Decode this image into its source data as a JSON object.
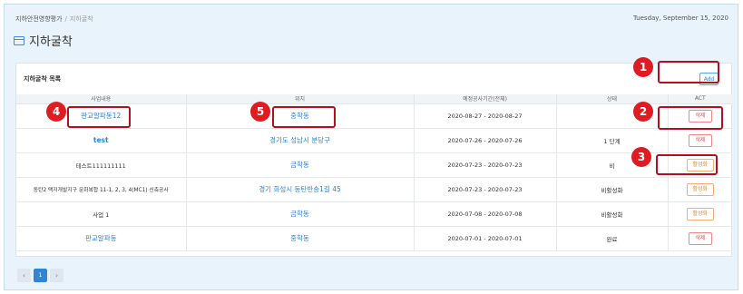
{
  "breadcrumb": {
    "root": "지하안전영향평가",
    "separator": "/",
    "current": "지하굴착"
  },
  "date": "Tuesday, September 15, 2020",
  "page_title": "지하굴착",
  "card": {
    "title": "지하굴착 목록",
    "add_label": "Add"
  },
  "columns": [
    "사업내용",
    "위치",
    "예정공사기간(전체)",
    "상태",
    "ACT"
  ],
  "rows": [
    {
      "name": "판교알파동12",
      "location": "중학동",
      "period": "2020-08-27 - 2020-08-27",
      "status": "",
      "action": "삭제"
    },
    {
      "name": "test",
      "location": "경기도 성남시 분당구",
      "period": "2020-07-26 - 2020-07-26",
      "status": "1 단계",
      "action": "삭제"
    },
    {
      "name": "테스트111111111",
      "location": "금학동",
      "period": "2020-07-23 - 2020-07-23",
      "status": "비",
      "action": "활성화"
    },
    {
      "name": "동탄2 택지개발지구 문화복합 11-1, 2, 3, 4(MC1) 신축공사",
      "location": "경기 화성시 동탄반송1길 45",
      "period": "2020-07-23 - 2020-07-23",
      "status": "비활성화",
      "action": "활성화"
    },
    {
      "name": "사업 1",
      "location": "금학동",
      "period": "2020-07-08 - 2020-07-08",
      "status": "비활성화",
      "action": "활성화"
    },
    {
      "name": "판교알파동",
      "location": "중학동",
      "period": "2020-07-01 - 2020-07-01",
      "status": "완료",
      "action": "삭제"
    }
  ],
  "pagination": {
    "prev": "‹",
    "page": "1",
    "next": "›"
  },
  "markers": [
    "1",
    "2",
    "3",
    "4",
    "5"
  ],
  "colors": {
    "accent": "#2f86d8",
    "danger": "#e05050",
    "warning": "#e08a30",
    "marker": "#e01b22",
    "background": "#e8f3fb"
  },
  "icons": {
    "page_title": "window-icon",
    "prev": "chevron-left-icon",
    "next": "chevron-right-icon"
  }
}
